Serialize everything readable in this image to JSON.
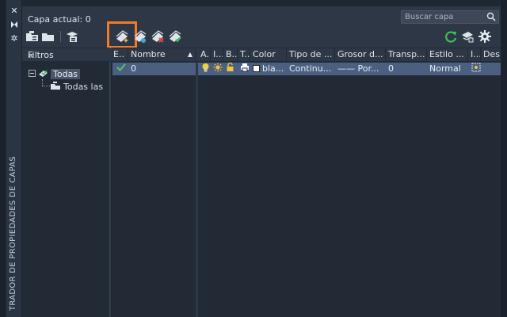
{
  "window": {
    "vertical_title": "TRADOR DE PROPIEDADES DE CAPAS",
    "close_icon": "close-icon",
    "autohide_icon": "autohide-icon",
    "properties_icon": "gear-icon"
  },
  "header": {
    "current_layer": "Capa actual: 0",
    "search_placeholder": "Buscar capa"
  },
  "toolbar": {
    "left_icons": [
      "new-property-filter-icon",
      "new-group-filter-icon",
      "layer-states-manager-icon"
    ],
    "layer_icons": [
      "new-layer-icon",
      "new-layer-vp-frozen-icon",
      "delete-layer-icon",
      "set-current-icon"
    ],
    "right_icons": [
      "refresh-icon",
      "settings-icon",
      "gear-icon"
    ]
  },
  "filters": {
    "title": "Filtros",
    "tree": [
      {
        "label": "Todas",
        "selected": true
      },
      {
        "label": "Todas las"
      }
    ]
  },
  "columns": {
    "left": [
      {
        "key": "estado",
        "label": "E.."
      },
      {
        "key": "nombre",
        "label": "Nombre"
      }
    ],
    "right": [
      {
        "key": "activar",
        "label": "A.."
      },
      {
        "key": "inutilizar",
        "label": "I..."
      },
      {
        "key": "bloquear",
        "label": "B..."
      },
      {
        "key": "trazar",
        "label": "T..."
      },
      {
        "key": "color",
        "label": "Color"
      },
      {
        "key": "tipo",
        "label": "Tipo de ..."
      },
      {
        "key": "grosor",
        "label": "Grosor d..."
      },
      {
        "key": "transp",
        "label": "Transp..."
      },
      {
        "key": "estilo",
        "label": "Estilo ..."
      },
      {
        "key": "inutvp",
        "label": "I..."
      },
      {
        "key": "desc",
        "label": "Des"
      }
    ]
  },
  "rows": [
    {
      "nombre": "0",
      "color": "bla...",
      "tipo": "Continu...",
      "grosor_line": "——",
      "grosor": "Por...",
      "transp": "0",
      "estilo": "Normal"
    }
  ],
  "colors": {
    "accent_highlight": "#f07b2a",
    "row_selected": "#4b5f80",
    "panel_bg": "#2d3746",
    "list_bg": "#222a35"
  }
}
